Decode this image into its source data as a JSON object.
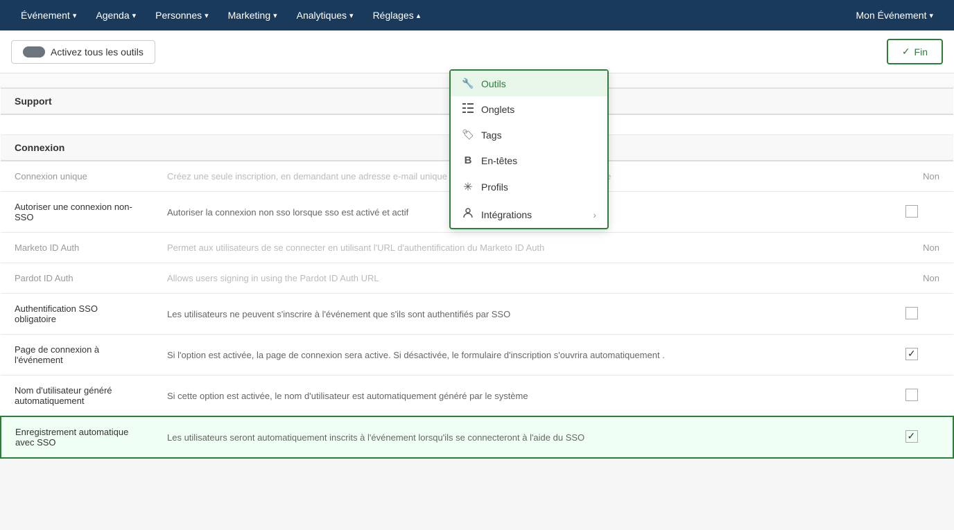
{
  "nav": {
    "items": [
      {
        "label": "Événement",
        "id": "evenement"
      },
      {
        "label": "Agenda",
        "id": "agenda"
      },
      {
        "label": "Personnes",
        "id": "personnes"
      },
      {
        "label": "Marketing",
        "id": "marketing"
      },
      {
        "label": "Analytiques",
        "id": "analytiques"
      },
      {
        "label": "Réglages",
        "id": "reglages"
      }
    ],
    "right_item": "Mon Événement"
  },
  "toolbar": {
    "activate_label": "Activez tous les outils",
    "fin_label": "Fin"
  },
  "dropdown": {
    "items": [
      {
        "id": "outils",
        "label": "Outils",
        "icon": "🔧",
        "active": true,
        "has_arrow": false
      },
      {
        "id": "onglets",
        "label": "Onglets",
        "icon": "☰",
        "active": false,
        "has_arrow": false
      },
      {
        "id": "tags",
        "label": "Tags",
        "icon": "🏷",
        "active": false,
        "has_arrow": false
      },
      {
        "id": "en-tetes",
        "label": "En-têtes",
        "icon": "B",
        "active": false,
        "has_arrow": false
      },
      {
        "id": "profils",
        "label": "Profils",
        "icon": "✳",
        "active": false,
        "has_arrow": false
      },
      {
        "id": "integrations",
        "label": "Intégrations",
        "icon": "👤",
        "active": false,
        "has_arrow": true
      }
    ]
  },
  "table": {
    "partial_top": "— — — — — — — —",
    "section_connexion": "Connexion",
    "rows": [
      {
        "id": "connexion-unique",
        "name": "Connexion unique",
        "name_muted": true,
        "desc": "Créez une seule inscription, en demandant une adresse e-mail unique et aucune récupération de mot de passe",
        "desc_muted": true,
        "type": "status",
        "status": "Non",
        "highlighted": false
      },
      {
        "id": "autoriser-non-sso",
        "name": "Autoriser une connexion non-SSO",
        "name_muted": false,
        "desc": "Autoriser la connexion non sso lorsque sso est activé et actif",
        "desc_muted": false,
        "type": "checkbox",
        "checked": false,
        "highlighted": false
      },
      {
        "id": "marketo-id-auth",
        "name": "Marketo ID Auth",
        "name_muted": true,
        "desc": "Permet aux utilisateurs de se connecter en utilisant l'URL d'authentification du Marketo ID Auth",
        "desc_muted": true,
        "type": "status",
        "status": "Non",
        "highlighted": false
      },
      {
        "id": "pardot-id-auth",
        "name": "Pardot ID Auth",
        "name_muted": true,
        "desc": "Allows users signing in using the Pardot ID Auth URL",
        "desc_muted": true,
        "type": "status",
        "status": "Non",
        "highlighted": false
      },
      {
        "id": "auth-sso-obligatoire",
        "name": "Authentification SSO obligatoire",
        "name_muted": false,
        "desc": "Les utilisateurs ne peuvent s'inscrire à l'événement que s'ils sont authentifiés par SSO",
        "desc_muted": false,
        "type": "checkbox",
        "checked": false,
        "highlighted": false
      },
      {
        "id": "page-connexion-evenement",
        "name": "Page de connexion à l'événement",
        "name_muted": false,
        "desc": "Si l'option est activée, la page de connexion sera active. Si désactivée, le formulaire d'inscription s'ouvrira automatiquement .",
        "desc_muted": false,
        "type": "checkbox",
        "checked": true,
        "highlighted": false
      },
      {
        "id": "nom-utilisateur-genere",
        "name": "Nom d'utilisateur généré automatiquement",
        "name_muted": false,
        "desc": "Si cette option est activée, le nom d'utilisateur est automatiquement généré par le système",
        "desc_muted": false,
        "type": "checkbox",
        "checked": false,
        "highlighted": false
      },
      {
        "id": "enregistrement-auto-sso",
        "name": "Enregistrement automatique avec SSO",
        "name_muted": false,
        "desc": "Les utilisateurs seront automatiquement inscrits à l'événement lorsqu'ils se connecteront à l'aide du SSO",
        "desc_muted": false,
        "type": "checkbox",
        "checked": true,
        "highlighted": true
      }
    ]
  }
}
